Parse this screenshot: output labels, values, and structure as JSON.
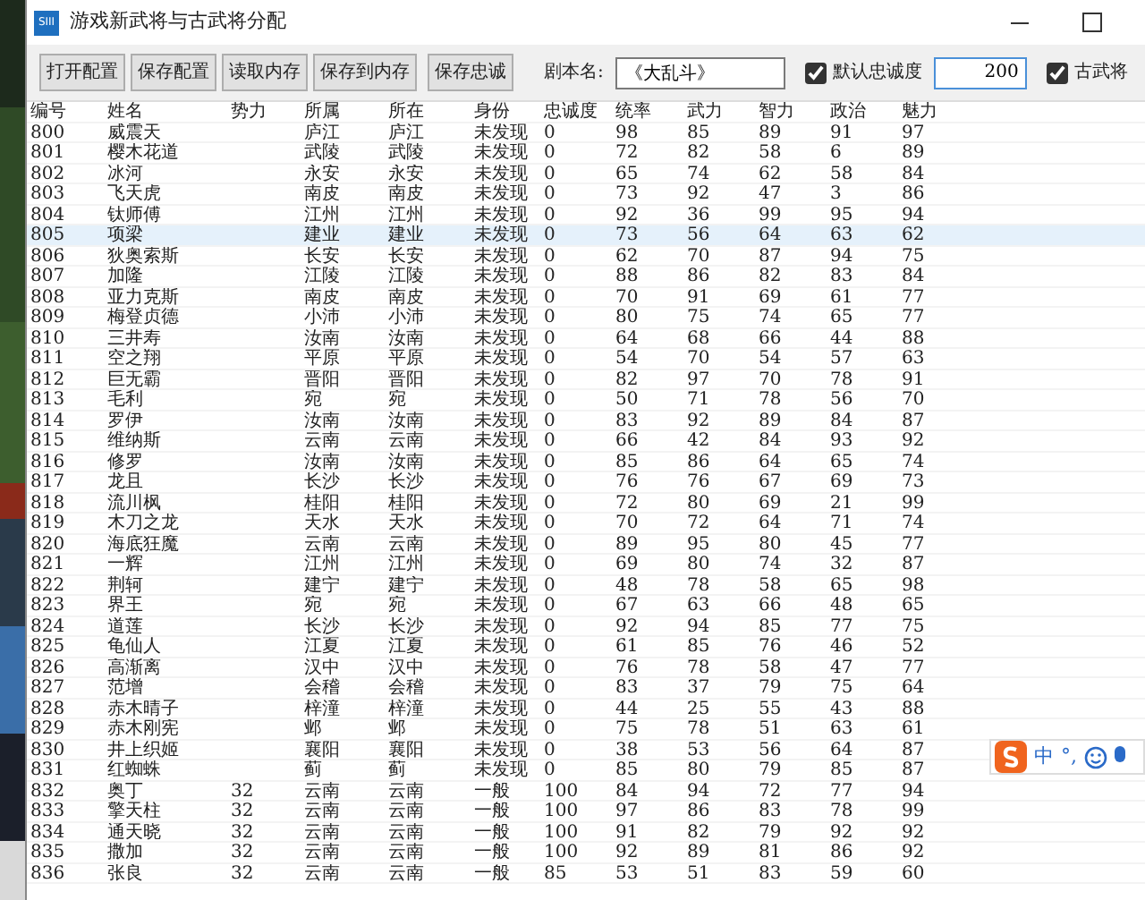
{
  "window": {
    "title": "游戏新武将与古武将分配",
    "app_icon": "SIII"
  },
  "toolbar": {
    "buttons": [
      "打开配置",
      "保存配置",
      "读取内存",
      "保存到内存",
      "保存忠诚"
    ],
    "script_name": {
      "label": "剧本名:",
      "value": "《大乱斗》"
    },
    "default_loyalty": {
      "label": "默认忠诚度",
      "checked": true,
      "value": "200"
    },
    "ancient_generals": {
      "label": "古武将",
      "checked": true
    }
  },
  "table": {
    "columns": [
      "编号",
      "姓名",
      "势力",
      "所属",
      "所在",
      "身份",
      "忠诚度",
      "统率",
      "武力",
      "智力",
      "政治",
      "魅力"
    ],
    "rows": [
      {
        "id": "800",
        "name": "威震天",
        "belongs": "庐江",
        "location": "庐江",
        "status": "未发现",
        "loyalty": "0",
        "command": "98",
        "force": "85",
        "intellect": "89",
        "politics": "91",
        "charm": "97",
        "selected": false
      },
      {
        "id": "801",
        "name": "樱木花道",
        "belongs": "武陵",
        "location": "武陵",
        "status": "未发现",
        "loyalty": "0",
        "command": "72",
        "force": "82",
        "intellect": "58",
        "politics": "6",
        "charm": "89",
        "selected": false
      },
      {
        "id": "802",
        "name": "冰河",
        "belongs": "永安",
        "location": "永安",
        "status": "未发现",
        "loyalty": "0",
        "command": "65",
        "force": "74",
        "intellect": "62",
        "politics": "58",
        "charm": "84",
        "selected": false
      },
      {
        "id": "803",
        "name": "飞天虎",
        "belongs": "南皮",
        "location": "南皮",
        "status": "未发现",
        "loyalty": "0",
        "command": "73",
        "force": "92",
        "intellect": "47",
        "politics": "3",
        "charm": "86",
        "selected": false
      },
      {
        "id": "804",
        "name": "钛师傅",
        "belongs": "江州",
        "location": "江州",
        "status": "未发现",
        "loyalty": "0",
        "command": "92",
        "force": "36",
        "intellect": "99",
        "politics": "95",
        "charm": "94",
        "selected": false
      },
      {
        "id": "805",
        "name": "项梁",
        "belongs": "建业",
        "location": "建业",
        "status": "未发现",
        "loyalty": "0",
        "command": "73",
        "force": "56",
        "intellect": "64",
        "politics": "63",
        "charm": "62",
        "selected": true
      },
      {
        "id": "806",
        "name": "狄奥索斯",
        "belongs": "长安",
        "location": "长安",
        "status": "未发现",
        "loyalty": "0",
        "command": "62",
        "force": "70",
        "intellect": "87",
        "politics": "94",
        "charm": "75",
        "selected": false
      },
      {
        "id": "807",
        "name": "加隆",
        "belongs": "江陵",
        "location": "江陵",
        "status": "未发现",
        "loyalty": "0",
        "command": "88",
        "force": "86",
        "intellect": "82",
        "politics": "83",
        "charm": "84",
        "selected": false
      },
      {
        "id": "808",
        "name": "亚力克斯",
        "belongs": "南皮",
        "location": "南皮",
        "status": "未发现",
        "loyalty": "0",
        "command": "70",
        "force": "91",
        "intellect": "69",
        "politics": "61",
        "charm": "77",
        "selected": false
      },
      {
        "id": "809",
        "name": "梅登贞德",
        "belongs": "小沛",
        "location": "小沛",
        "status": "未发现",
        "loyalty": "0",
        "command": "80",
        "force": "75",
        "intellect": "74",
        "politics": "65",
        "charm": "77",
        "selected": false
      },
      {
        "id": "810",
        "name": "三井寿",
        "belongs": "汝南",
        "location": "汝南",
        "status": "未发现",
        "loyalty": "0",
        "command": "64",
        "force": "68",
        "intellect": "66",
        "politics": "44",
        "charm": "88",
        "selected": false
      },
      {
        "id": "811",
        "name": "空之翔",
        "belongs": "平原",
        "location": "平原",
        "status": "未发现",
        "loyalty": "0",
        "command": "54",
        "force": "70",
        "intellect": "54",
        "politics": "57",
        "charm": "63",
        "selected": false
      },
      {
        "id": "812",
        "name": "巨无霸",
        "belongs": "晋阳",
        "location": "晋阳",
        "status": "未发现",
        "loyalty": "0",
        "command": "82",
        "force": "97",
        "intellect": "70",
        "politics": "78",
        "charm": "91",
        "selected": false
      },
      {
        "id": "813",
        "name": "毛利",
        "belongs": "宛",
        "location": "宛",
        "status": "未发现",
        "loyalty": "0",
        "command": "50",
        "force": "71",
        "intellect": "78",
        "politics": "56",
        "charm": "70",
        "selected": false
      },
      {
        "id": "814",
        "name": "罗伊",
        "belongs": "汝南",
        "location": "汝南",
        "status": "未发现",
        "loyalty": "0",
        "command": "83",
        "force": "92",
        "intellect": "89",
        "politics": "84",
        "charm": "87",
        "selected": false
      },
      {
        "id": "815",
        "name": "维纳斯",
        "belongs": "云南",
        "location": "云南",
        "status": "未发现",
        "loyalty": "0",
        "command": "66",
        "force": "42",
        "intellect": "84",
        "politics": "93",
        "charm": "92",
        "selected": false
      },
      {
        "id": "816",
        "name": "修罗",
        "belongs": "汝南",
        "location": "汝南",
        "status": "未发现",
        "loyalty": "0",
        "command": "85",
        "force": "86",
        "intellect": "64",
        "politics": "65",
        "charm": "74",
        "selected": false
      },
      {
        "id": "817",
        "name": "龙且",
        "belongs": "长沙",
        "location": "长沙",
        "status": "未发现",
        "loyalty": "0",
        "command": "76",
        "force": "76",
        "intellect": "67",
        "politics": "69",
        "charm": "73",
        "selected": false
      },
      {
        "id": "818",
        "name": "流川枫",
        "belongs": "桂阳",
        "location": "桂阳",
        "status": "未发现",
        "loyalty": "0",
        "command": "72",
        "force": "80",
        "intellect": "69",
        "politics": "21",
        "charm": "99",
        "selected": false
      },
      {
        "id": "819",
        "name": "木刀之龙",
        "belongs": "天水",
        "location": "天水",
        "status": "未发现",
        "loyalty": "0",
        "command": "70",
        "force": "72",
        "intellect": "64",
        "politics": "71",
        "charm": "74",
        "selected": false
      },
      {
        "id": "820",
        "name": "海底狂魔",
        "belongs": "云南",
        "location": "云南",
        "status": "未发现",
        "loyalty": "0",
        "command": "89",
        "force": "95",
        "intellect": "80",
        "politics": "45",
        "charm": "77",
        "selected": false
      },
      {
        "id": "821",
        "name": "一辉",
        "belongs": "江州",
        "location": "江州",
        "status": "未发现",
        "loyalty": "0",
        "command": "69",
        "force": "80",
        "intellect": "74",
        "politics": "32",
        "charm": "87",
        "selected": false
      },
      {
        "id": "822",
        "name": "荆轲",
        "belongs": "建宁",
        "location": "建宁",
        "status": "未发现",
        "loyalty": "0",
        "command": "48",
        "force": "78",
        "intellect": "58",
        "politics": "65",
        "charm": "98",
        "selected": false
      },
      {
        "id": "823",
        "name": "界王",
        "belongs": "宛",
        "location": "宛",
        "status": "未发现",
        "loyalty": "0",
        "command": "67",
        "force": "63",
        "intellect": "66",
        "politics": "48",
        "charm": "65",
        "selected": false
      },
      {
        "id": "824",
        "name": "道莲",
        "belongs": "长沙",
        "location": "长沙",
        "status": "未发现",
        "loyalty": "0",
        "command": "92",
        "force": "94",
        "intellect": "85",
        "politics": "77",
        "charm": "75",
        "selected": false
      },
      {
        "id": "825",
        "name": "龟仙人",
        "belongs": "江夏",
        "location": "江夏",
        "status": "未发现",
        "loyalty": "0",
        "command": "61",
        "force": "85",
        "intellect": "76",
        "politics": "46",
        "charm": "52",
        "selected": false
      },
      {
        "id": "826",
        "name": "高渐离",
        "belongs": "汉中",
        "location": "汉中",
        "status": "未发现",
        "loyalty": "0",
        "command": "76",
        "force": "78",
        "intellect": "58",
        "politics": "47",
        "charm": "77",
        "selected": false
      },
      {
        "id": "827",
        "name": "范增",
        "belongs": "会稽",
        "location": "会稽",
        "status": "未发现",
        "loyalty": "0",
        "command": "83",
        "force": "37",
        "intellect": "79",
        "politics": "75",
        "charm": "64",
        "selected": false
      },
      {
        "id": "828",
        "name": "赤木晴子",
        "belongs": "梓潼",
        "location": "梓潼",
        "status": "未发现",
        "loyalty": "0",
        "command": "44",
        "force": "25",
        "intellect": "55",
        "politics": "43",
        "charm": "88",
        "selected": false
      },
      {
        "id": "829",
        "name": "赤木刚宪",
        "belongs": "邺",
        "location": "邺",
        "status": "未发现",
        "loyalty": "0",
        "command": "75",
        "force": "78",
        "intellect": "51",
        "politics": "63",
        "charm": "61",
        "selected": false
      },
      {
        "id": "830",
        "name": "井上织姬",
        "belongs": "襄阳",
        "location": "襄阳",
        "status": "未发现",
        "loyalty": "0",
        "command": "38",
        "force": "53",
        "intellect": "56",
        "politics": "64",
        "charm": "87",
        "selected": false
      },
      {
        "id": "831",
        "name": "红蜘蛛",
        "belongs": "蓟",
        "location": "蓟",
        "status": "未发现",
        "loyalty": "0",
        "command": "85",
        "force": "80",
        "intellect": "79",
        "politics": "85",
        "charm": "87",
        "selected": false
      },
      {
        "id": "832",
        "name": "奥丁",
        "faction": "32",
        "belongs": "云南",
        "location": "云南",
        "status": "一般",
        "loyalty": "100",
        "command": "84",
        "force": "94",
        "intellect": "72",
        "politics": "77",
        "charm": "94",
        "selected": false
      },
      {
        "id": "833",
        "name": "擎天柱",
        "faction": "32",
        "belongs": "云南",
        "location": "云南",
        "status": "一般",
        "loyalty": "100",
        "command": "97",
        "force": "86",
        "intellect": "83",
        "politics": "78",
        "charm": "99",
        "selected": false
      },
      {
        "id": "834",
        "name": "通天晓",
        "faction": "32",
        "belongs": "云南",
        "location": "云南",
        "status": "一般",
        "loyalty": "100",
        "command": "91",
        "force": "82",
        "intellect": "79",
        "politics": "92",
        "charm": "92",
        "selected": false
      },
      {
        "id": "835",
        "name": "撒加",
        "faction": "32",
        "belongs": "云南",
        "location": "云南",
        "status": "一般",
        "loyalty": "100",
        "command": "92",
        "force": "89",
        "intellect": "81",
        "politics": "86",
        "charm": "92",
        "selected": false
      },
      {
        "id": "836",
        "name": "张良",
        "faction": "32",
        "belongs": "云南",
        "location": "云南",
        "status": "一般",
        "loyalty": "85",
        "command": "53",
        "force": "51",
        "intellect": "83",
        "politics": "59",
        "charm": "60",
        "selected": false
      }
    ]
  },
  "ime_toolbar": {
    "mode": "中",
    "punctuation": "°,"
  }
}
